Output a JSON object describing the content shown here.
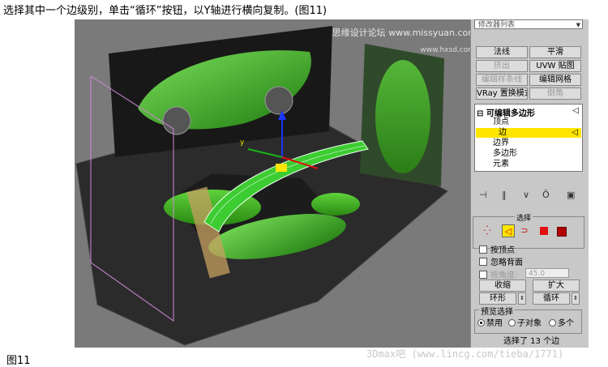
{
  "caption": {
    "top": "选择其中一个边级别，单击“循环”按钮，以Y轴进行横向复制。(图11)",
    "bottom": "图11",
    "watermark_bottom": "3Dmax吧 (www.lincg.com/tieba/1771)"
  },
  "viewport": {
    "watermark": "思缘设计论坛 www.missyuan.com",
    "watermark_small": "www.hxsd.com",
    "axis_label": "y"
  },
  "panel": {
    "dropdown_value": "修改器列表",
    "buttons": {
      "normal": "法线",
      "smooth": "平滑",
      "extrude": "挤出",
      "uvw_map": "UVW 贴图",
      "edit_spline": "编辑样条线",
      "edit_mesh": "编辑网格",
      "vray_displace": "VRay 置换模式",
      "chamfer": "倒角"
    },
    "tree": {
      "root": "可编辑多边形",
      "items": [
        "顶点",
        "边",
        "边界",
        "多边形",
        "元素"
      ],
      "selected": "边"
    },
    "rollout_title": "选择",
    "selection_options": {
      "by_vertex": "按顶点",
      "ignore_backfacing": "忽略背面",
      "by_angle": "按角度:",
      "angle_value": "45.0"
    },
    "buttons2": {
      "shrink": "收缩",
      "grow": "扩大",
      "ring": "环形",
      "loop": "循环"
    },
    "preview": {
      "title": "预览选择",
      "off": "禁用",
      "subobject": "子对象",
      "multi": "多个"
    },
    "status": "选择了 13 个边"
  },
  "colors": {
    "viewport_bg": "#7a7a7a",
    "panel_bg": "#c8c8c8",
    "highlight": "#ffe600",
    "car_green": "#3dbb1e",
    "gizmo_blue": "#1a35ff",
    "gizmo_red": "#e01010"
  }
}
